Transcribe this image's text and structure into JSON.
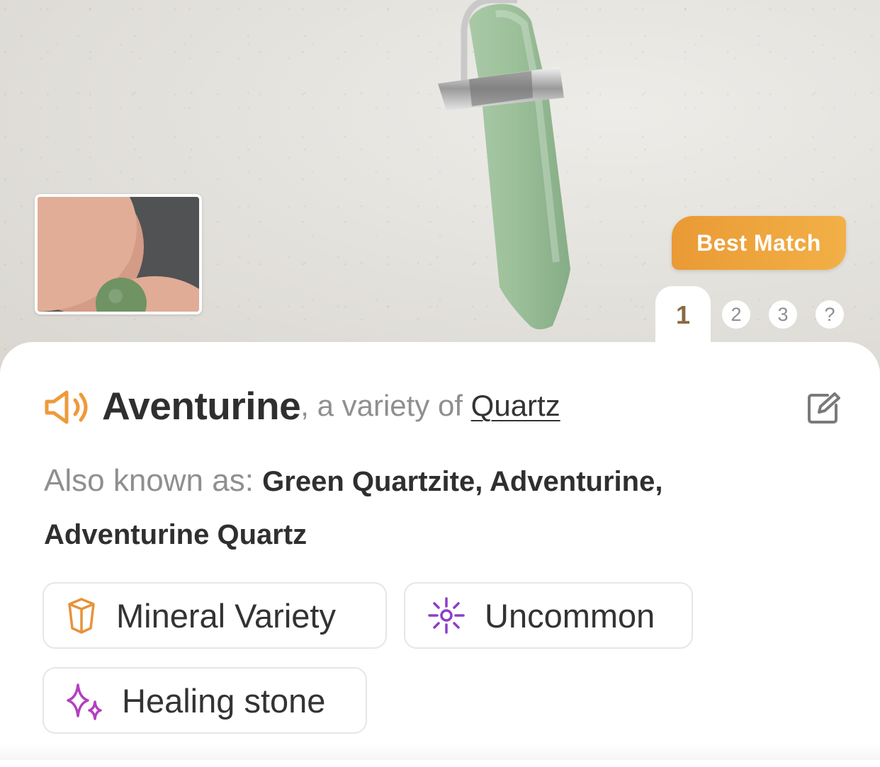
{
  "header": {
    "badge_label": "Best Match",
    "tabs": [
      {
        "label": "1",
        "active": true
      },
      {
        "label": "2",
        "active": false
      },
      {
        "label": "3",
        "active": false
      },
      {
        "label": "?",
        "active": false
      }
    ]
  },
  "result": {
    "name": "Aventurine",
    "variety_text": ", a variety of ",
    "parent_mineral": "Quartz",
    "aka_label": "Also known as: ",
    "aka_names": "Green Quartzite, Adventurine, Adventurine Quartz"
  },
  "tags": [
    {
      "label": "Mineral Variety",
      "icon": "crystal-icon",
      "color": "#e8923a"
    },
    {
      "label": "Uncommon",
      "icon": "sparkle-burst-icon",
      "color": "#8b3fc7"
    },
    {
      "label": "Healing stone",
      "icon": "sparkles-icon",
      "color": "#b43fc0"
    }
  ],
  "colors": {
    "accent_orange": "#ee9a3a",
    "text_dark": "#2f2f2f",
    "text_muted": "#8f8f8f"
  }
}
